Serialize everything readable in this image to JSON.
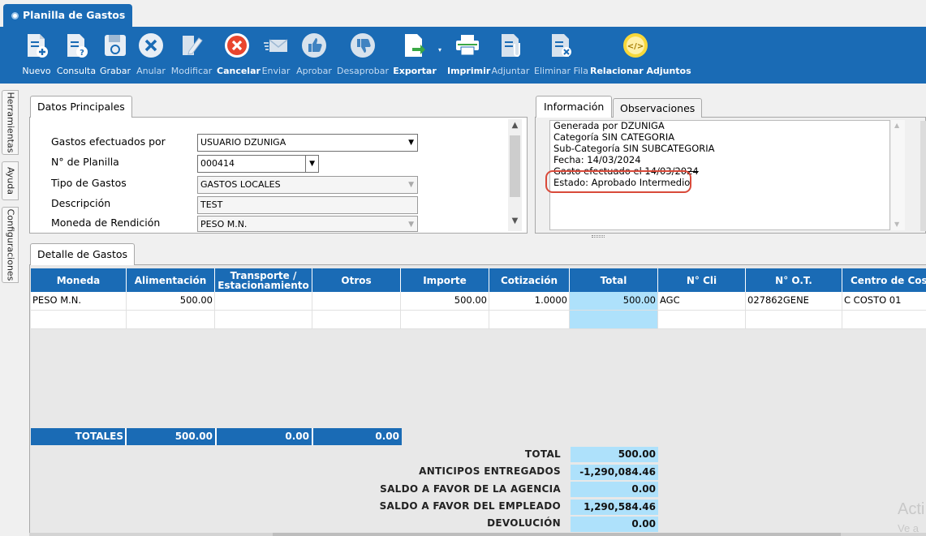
{
  "window": {
    "title": "Planilla de Gastos"
  },
  "toolbar": {
    "items": [
      {
        "label": "Nuevo",
        "icon": "doc-add-icon"
      },
      {
        "label": "Consulta",
        "icon": "doc-query-icon"
      },
      {
        "label": "Grabar",
        "icon": "save-icon"
      },
      {
        "label": "Anular",
        "icon": "void-x-icon"
      },
      {
        "label": "Modificar",
        "icon": "edit-pencil-icon"
      },
      {
        "label": "Cancelar",
        "icon": "cancel-icon"
      },
      {
        "label": "Enviar",
        "icon": "send-mail-icon"
      },
      {
        "label": "Aprobar",
        "icon": "thumbs-up-icon"
      },
      {
        "label": "Desaprobar",
        "icon": "thumbs-down-icon"
      },
      {
        "label": "Exportar",
        "icon": "export-icon"
      },
      {
        "label": "Imprimir",
        "icon": "printer-icon"
      },
      {
        "label": "Adjuntar",
        "icon": "attach-icon"
      },
      {
        "label": "Eliminar Fila",
        "icon": "delete-row-icon"
      },
      {
        "label": "Relacionar Adjuntos",
        "icon": "link-attachments-icon"
      }
    ]
  },
  "side_tabs": [
    "Herramientas",
    "Ayuda",
    "Configuraciones"
  ],
  "datos": {
    "tab": "Datos Principales",
    "gastos_label": "Gastos efectuados por",
    "gastos_value": "USUARIO DZUNIGA",
    "planilla_label": "N° de Planilla",
    "planilla_value": "000414",
    "tipo_label": "Tipo de Gastos",
    "tipo_value": "GASTOS LOCALES",
    "descripcion_label": "Descripción",
    "descripcion_value": "TEST",
    "moneda_label": "Moneda de Rendición",
    "moneda_value": "PESO M.N."
  },
  "info": {
    "tab_info": "Información",
    "tab_obs": "Observaciones",
    "lines": [
      "Generada por DZUNIGA",
      "Categoría SIN CATEGORIA",
      "Sub-Categoría SIN SUBCATEGORIA",
      "Fecha: 14/03/2024",
      "Gasto efectuado el 14/03/2024",
      "Estado: Aprobado Intermedio"
    ]
  },
  "detalle": {
    "tab": "Detalle de Gastos",
    "columns": [
      "Moneda",
      "Alimentación",
      "Transporte / Estacionamiento",
      "Otros",
      "Importe",
      "Cotización",
      "Total",
      "N° Cli",
      "N° O.T.",
      "Centro de Costo"
    ],
    "rows": [
      [
        "PESO M.N.",
        "500.00",
        "",
        "",
        "500.00",
        "1.0000",
        "500.00",
        "AGC",
        "027862GENE",
        "C COSTO 01"
      ]
    ],
    "totals_label": "TOTALES",
    "totals": [
      "500.00",
      "0.00",
      "0.00"
    ]
  },
  "summary": [
    {
      "label": "TOTAL",
      "value": "500.00"
    },
    {
      "label": "ANTICIPOS ENTREGADOS",
      "value": "-1,290,084.46"
    },
    {
      "label": "SALDO A FAVOR DE LA AGENCIA",
      "value": "0.00"
    },
    {
      "label": "SALDO A FAVOR DEL EMPLEADO",
      "value": "1,290,584.46"
    },
    {
      "label": "DEVOLUCIÓN",
      "value": "0.00"
    }
  ],
  "watermark": {
    "line1": "Acti",
    "line2": "Ve a"
  },
  "colors": {
    "accent": "#1a6bb5",
    "highlight_cell": "#aee1fb",
    "annotation_ring": "#d94a3a"
  }
}
